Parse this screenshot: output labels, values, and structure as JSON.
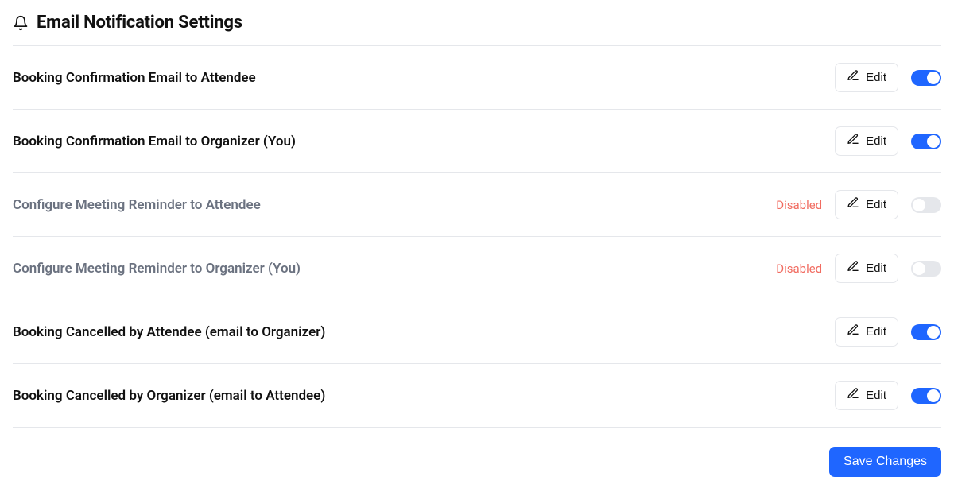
{
  "header": {
    "title": "Email Notification Settings"
  },
  "labels": {
    "edit": "Edit",
    "disabled": "Disabled",
    "save": "Save Changes"
  },
  "rows": [
    {
      "title": "Booking Confirmation Email to Attendee",
      "enabled": true
    },
    {
      "title": "Booking Confirmation Email to Organizer (You)",
      "enabled": true
    },
    {
      "title": "Configure Meeting Reminder to Attendee",
      "enabled": false
    },
    {
      "title": "Configure Meeting Reminder to Organizer (You)",
      "enabled": false
    },
    {
      "title": "Booking Cancelled by Attendee (email to Organizer)",
      "enabled": true
    },
    {
      "title": "Booking Cancelled by Organizer (email to Attendee)",
      "enabled": true
    }
  ]
}
